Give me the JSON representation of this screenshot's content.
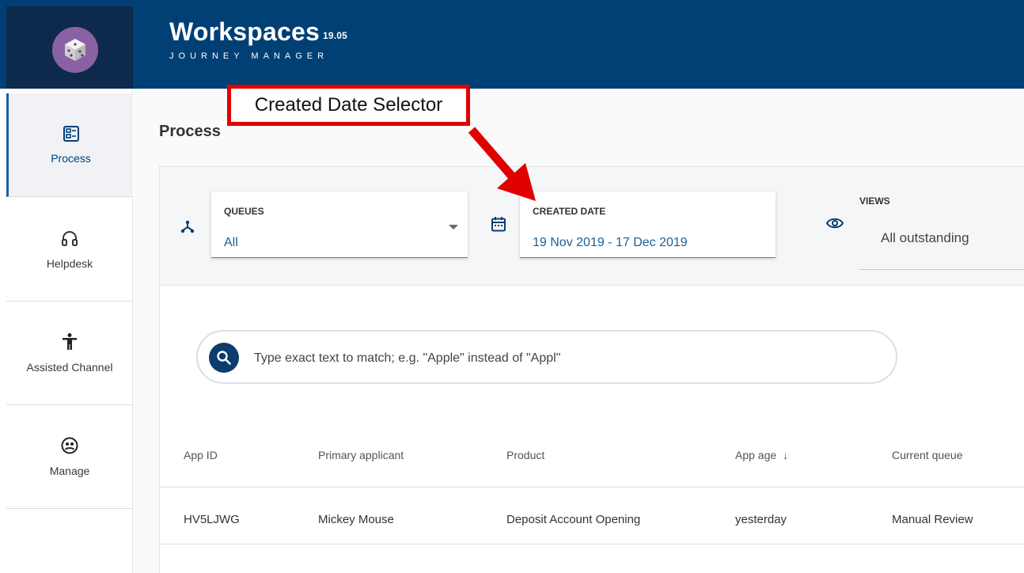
{
  "app": {
    "title": "Workspaces",
    "version": "19.05",
    "subtitle": "JOURNEY MANAGER"
  },
  "sidebar": {
    "items": [
      {
        "label": "Process",
        "icon": "process-icon",
        "active": true
      },
      {
        "label": "Helpdesk",
        "icon": "headphones-icon",
        "active": false
      },
      {
        "label": "Assisted Channel",
        "icon": "accessibility-icon",
        "active": false
      },
      {
        "label": "Manage",
        "icon": "manage-icon",
        "active": false
      }
    ]
  },
  "main": {
    "page_title": "Process",
    "filters": {
      "queues": {
        "caption": "QUEUES",
        "value": "All",
        "icon": "queue-fork-icon"
      },
      "created_date": {
        "caption": "CREATED DATE",
        "value": "19 Nov 2019 - 17 Dec 2019",
        "icon": "calendar-icon"
      },
      "views": {
        "caption": "VIEWS",
        "value": "All outstanding",
        "icon": "eye-icon"
      }
    },
    "search": {
      "placeholder": "Type exact text to match; e.g. \"Apple\" instead of \"Appl\"",
      "icon": "search-icon"
    },
    "table": {
      "columns": [
        "App ID",
        "Primary applicant",
        "Product",
        "App age",
        "Current queue"
      ],
      "sort_indicator": "↓",
      "rows": [
        [
          "HV5LJWG",
          "Mickey Mouse",
          "Deposit Account Opening",
          "yesterday",
          "Manual Review"
        ]
      ]
    }
  },
  "annotation": {
    "label": "Created Date Selector",
    "color": "#e00000"
  },
  "colors": {
    "header": "#004074",
    "logo_bg": "#0d2a4c",
    "accent": "#1f5c99"
  }
}
